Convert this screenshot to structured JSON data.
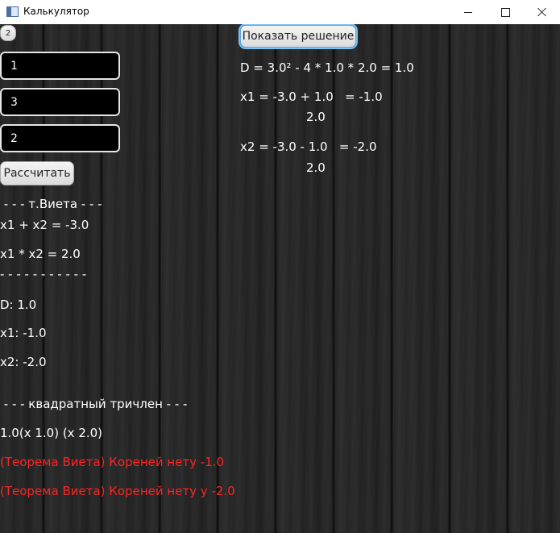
{
  "window": {
    "title": "Калькулятор"
  },
  "left": {
    "counter_button": "2",
    "inputs": [
      "1",
      "3",
      "2"
    ],
    "calculate_button": "Рассчитать",
    "vieta_header": " - - - т.Виета - - -",
    "vieta_sum": "x1 + x2 = -3.0",
    "vieta_product": "x1 * x2 = 2.0",
    "divider": "- - - - - - - - - - -",
    "discriminant": "D: 1.0",
    "root1": "x1: -1.0",
    "root2": "x2: -2.0",
    "trinomial_header": " - - - квадратный тричлен - - -",
    "trinomial": "1.0(x 1.0) (x 2.0)",
    "vieta_error_x": "(Теорема Виета) Кореней нету -1.0",
    "vieta_error_y": "(Теорема Виета) Кореней нету y -2.0"
  },
  "right": {
    "show_solution_button": "Показать решение",
    "discriminant_formula": "D = 3.0² - 4 * 1.0 * 2.0 = 1.0",
    "x1_numerator": "x1 = -3.0 + 1.0   = -1.0",
    "x1_denominator": "2.0",
    "x2_numerator": "x2 = -3.0 - 1.0   = -2.0",
    "x2_denominator": "2.0"
  },
  "colors": {
    "text": "#ffffff",
    "error_text": "#ff2323",
    "focus_ring": "#7cc0f0"
  }
}
